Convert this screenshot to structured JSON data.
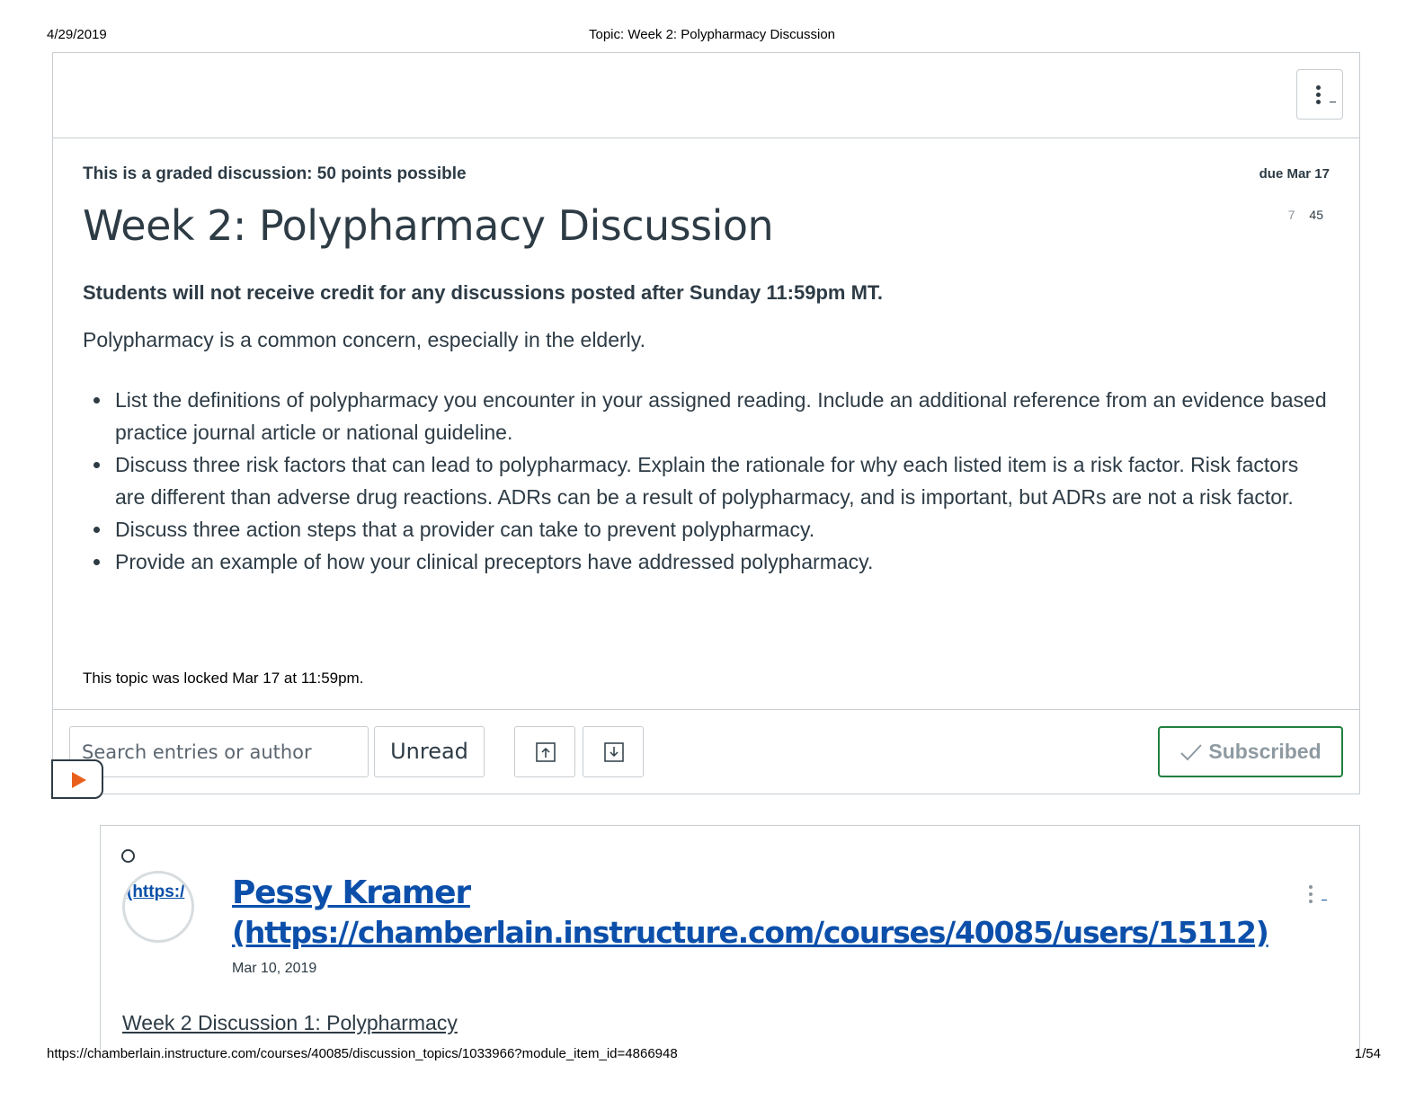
{
  "print": {
    "date": "4/29/2019",
    "title": "Topic: Week 2: Polypharmacy Discussion",
    "url": "https://chamberlain.instructure.com/courses/40085/discussion_topics/1033966?module_item_id=4866948",
    "page": "1/54"
  },
  "topic": {
    "graded_label": "This is a graded discussion: 50 points possible",
    "due": "due Mar 17",
    "unread_count": "7",
    "total_count": "45",
    "title": "Week 2: Polypharmacy Discussion",
    "warning": "Students will not receive credit for any discussions posted after Sunday 11:59pm MT.",
    "intro": "Polypharmacy is a common concern, especially in the elderly.",
    "bullets": [
      "List the definitions of polypharmacy you encounter in your assigned reading. Include an additional reference from an evidence based practice journal article or national guideline.",
      "Discuss three risk factors that can lead to polypharmacy. Explain the rationale for why each listed item is a risk factor. Risk factors are different than adverse drug reactions. ADRs can be a result of polypharmacy, and is important, but ADRs are not a risk factor.",
      "Discuss three action steps that a provider can take to prevent polypharmacy.",
      "Provide an example of how your clinical preceptors have addressed polypharmacy."
    ],
    "locked_text": "This topic was locked Mar 17 at 11:59pm."
  },
  "actions": {
    "search_placeholder": "Search entries or author",
    "unread_label": "Unread",
    "subscribed_label": "Subscribed",
    "icons": [
      "kebab-menu-icon",
      "collapse-replies-icon",
      "expand-replies-icon",
      "checkmark-icon",
      "play-icon"
    ]
  },
  "entry": {
    "avatar_link_text": "(https:/",
    "author_name": "Pessy Kramer",
    "author_url": "(https://chamberlain.instructure.com/courses/40085/users/15112)",
    "date": "Mar 10, 2019",
    "heading": "Week 2 Discussion 1: Polypharmacy"
  },
  "colors": {
    "text": "#2d3b45",
    "link": "#0b4faa",
    "border": "#c7cdd1",
    "subscribed_border": "#1f7f3f",
    "media_orange": "#e8601c"
  }
}
